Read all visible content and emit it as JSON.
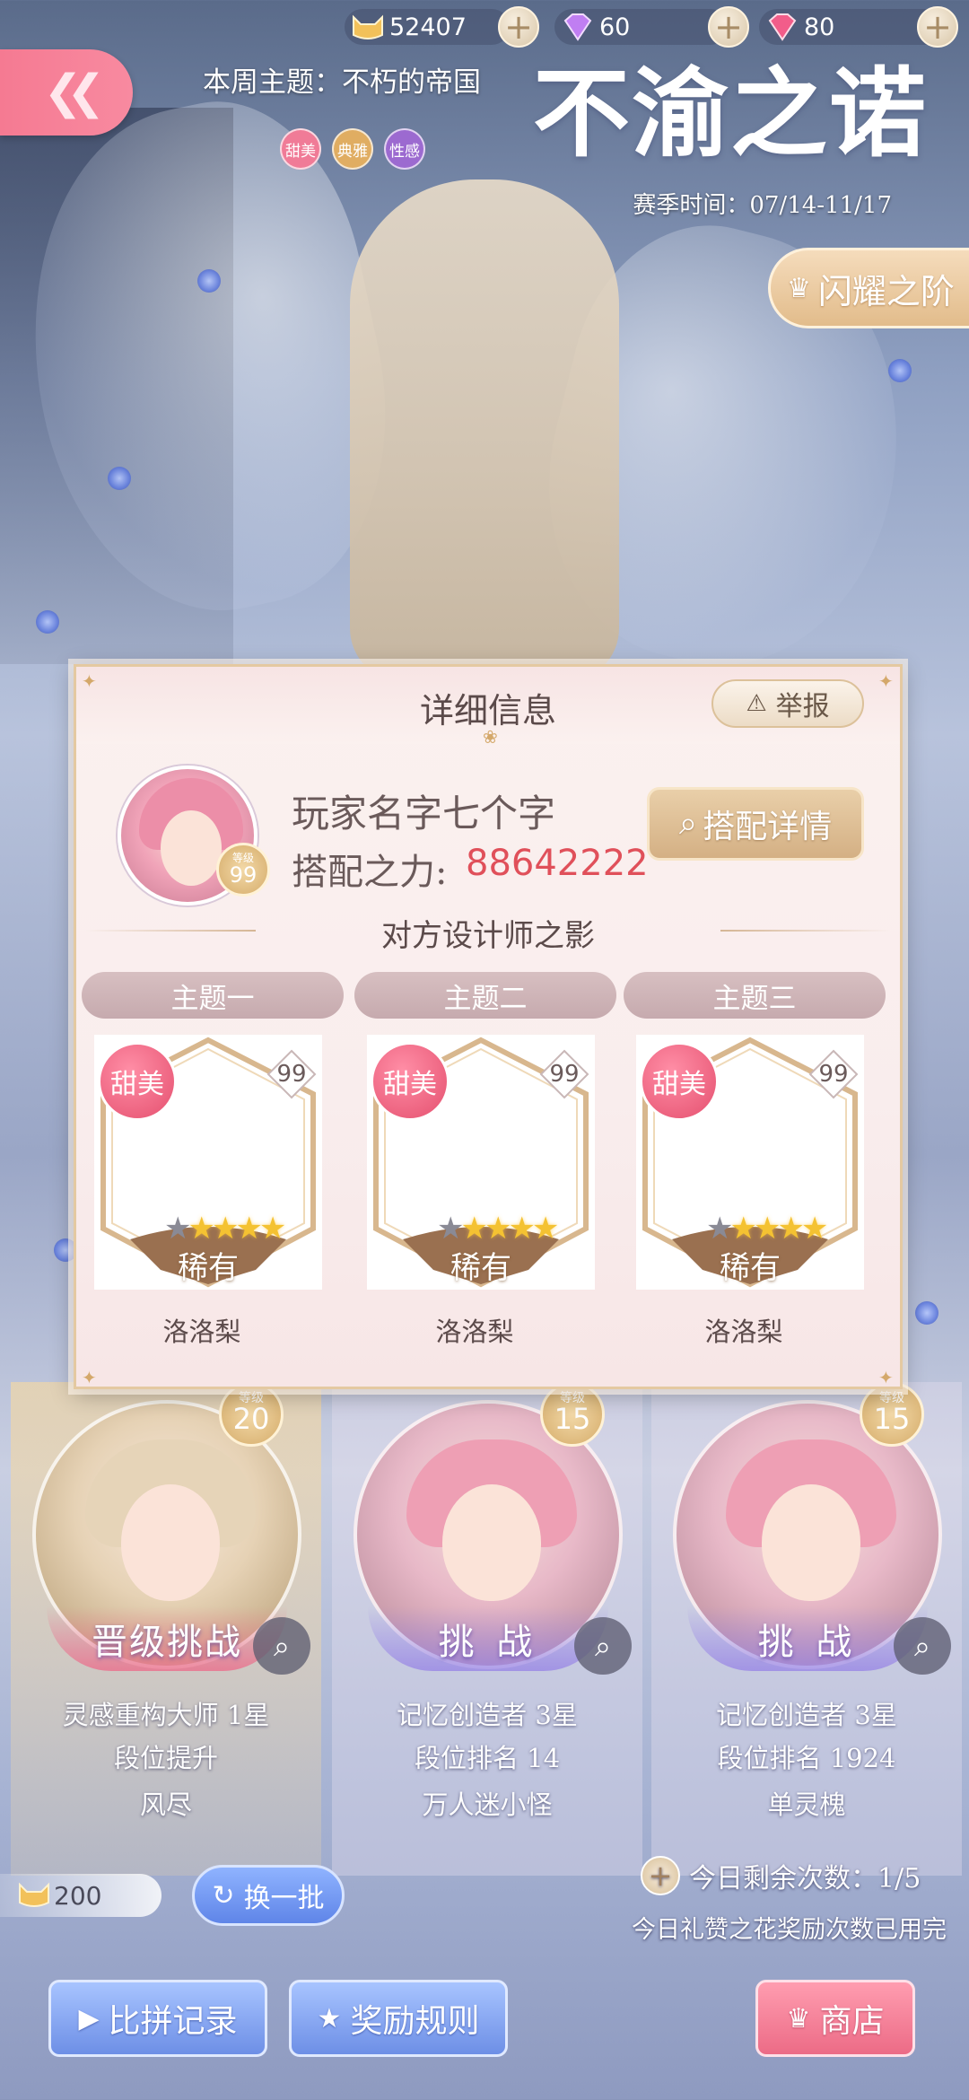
{
  "currency": {
    "cat_coins": "52407",
    "diamond_purple": "60",
    "diamond_pink": "80",
    "plus_symbol": "+"
  },
  "header": {
    "weekly_theme": "本周主题：不朽的帝国",
    "tags": [
      {
        "label": "甜美",
        "color": "#f07b97"
      },
      {
        "label": "典雅",
        "color": "#e0ad62"
      },
      {
        "label": "性感",
        "color": "#9c6ad0"
      }
    ],
    "logo": "不渝之诺",
    "season_time": "赛季时间：07/14-11/17",
    "shine_button": "闪耀之阶"
  },
  "modal": {
    "title": "详细信息",
    "report_label": "举报",
    "player_name": "玩家名字七个字",
    "level_small": "等级",
    "level": "99",
    "power_label": "搭配之力:",
    "power_value": "88642222",
    "outfit_detail_label": "搭配详情",
    "section_title": "对方设计师之影",
    "themes": [
      {
        "header": "主题一",
        "badge": "甜美",
        "number": "99",
        "rarity": "稀有",
        "name": "洛洛梨",
        "stars_total": 5,
        "stars_lit": 4
      },
      {
        "header": "主题二",
        "badge": "甜美",
        "number": "99",
        "rarity": "稀有",
        "name": "洛洛梨",
        "stars_total": 5,
        "stars_lit": 4
      },
      {
        "header": "主题三",
        "badge": "甜美",
        "number": "99",
        "rarity": "稀有",
        "name": "洛洛梨",
        "stars_total": 5,
        "stars_lit": 4
      }
    ]
  },
  "opponents": [
    {
      "level_small": "等级",
      "level": "20",
      "action": "晋级挑战",
      "line1": "灵感重构大师 1星",
      "line2": "段位提升",
      "line3": "风尽"
    },
    {
      "level_small": "等级",
      "level": "15",
      "action": "挑 战",
      "line1": "记忆创造者 3星",
      "line2": "段位排名 14",
      "line3": "万人迷小怪"
    },
    {
      "level_small": "等级",
      "level": "15",
      "action": "挑 战",
      "line1": "记忆创造者 3星",
      "line2": "段位排名 1924",
      "line3": "单灵槐"
    }
  ],
  "footer": {
    "coin_amount": "200",
    "swap_label": "换一批",
    "remaining": "今日剩余次数：1/5",
    "flower_message": "今日礼赞之花奖励次数已用完",
    "buttons": {
      "record": "比拼记录",
      "rules": "奖励规则",
      "shop": "商店"
    }
  },
  "colors": {
    "accent_pink": "#f57a92",
    "gold": "#d5ac6a",
    "power_red": "#e0505a"
  }
}
